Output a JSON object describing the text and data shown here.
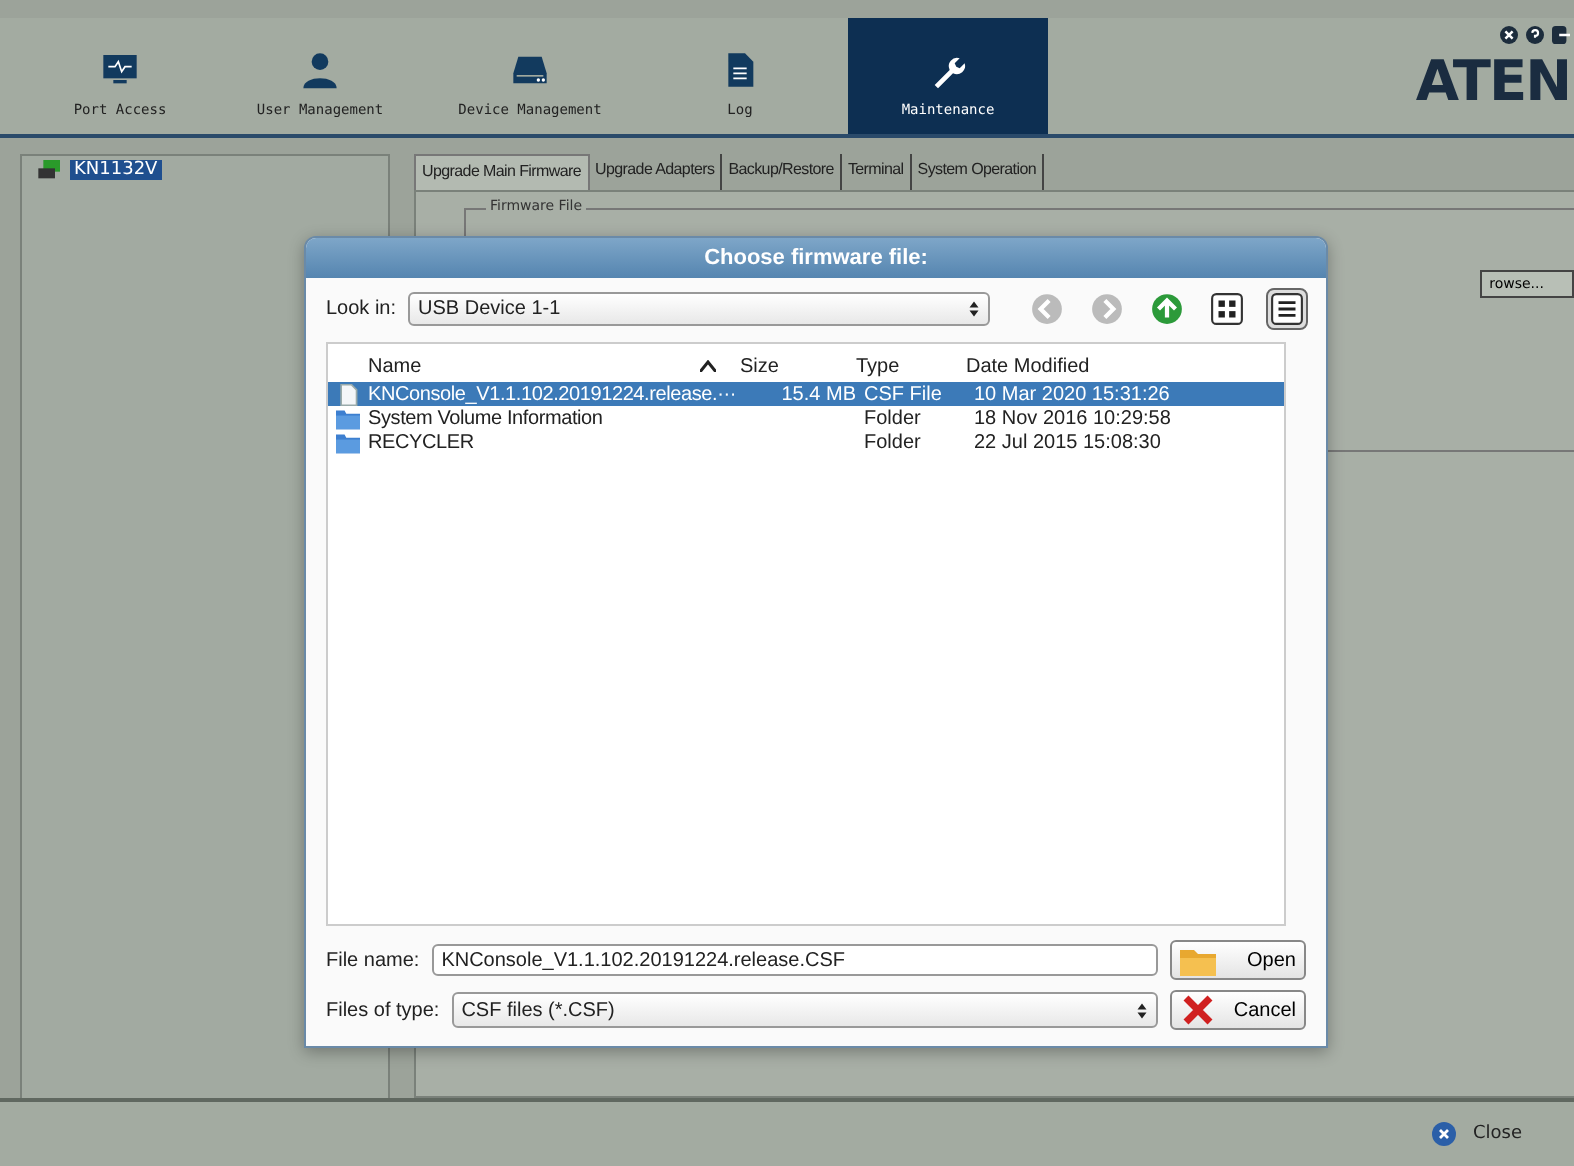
{
  "nav": [
    {
      "label": "Port Access",
      "selected": false
    },
    {
      "label": "User Management",
      "selected": false
    },
    {
      "label": "Device Management",
      "selected": false
    },
    {
      "label": "Log",
      "selected": false
    },
    {
      "label": "Maintenance",
      "selected": true
    }
  ],
  "logo": "ATEN",
  "tree": [
    {
      "label": "KN1132V",
      "selected": true
    }
  ],
  "tabs": [
    {
      "label": "Upgrade Main Firmware",
      "selected": true
    },
    {
      "label": "Upgrade Adapters",
      "selected": false
    },
    {
      "label": "Backup/Restore",
      "selected": false
    },
    {
      "label": "Terminal",
      "selected": false
    },
    {
      "label": "System Operation",
      "selected": false
    }
  ],
  "firmware_group": {
    "legend": "Firmware File",
    "browse_button": "rowse..."
  },
  "dialog": {
    "title": "Choose firmware file:",
    "look_in_label": "Look in:",
    "look_in_value": "USB Device 1-1",
    "view_buttons": [
      {
        "selected": false
      },
      {
        "selected": true
      }
    ],
    "columns": [
      "Name",
      "Size",
      "Type",
      "Date Modified"
    ],
    "rows": [
      {
        "kind": "file",
        "name": "KNConsole_V1.1.102.20191224.release.···",
        "size": "15.4 MB",
        "type": "CSF File",
        "date": "10 Mar 2020 15:31:26",
        "selected": true
      },
      {
        "kind": "folder",
        "name": "System Volume Information",
        "type": "Folder",
        "date": "18 Nov 2016 10:29:58",
        "selected": false
      },
      {
        "kind": "folder",
        "name": "RECYCLER",
        "type": "Folder",
        "date": "22 Jul 2015 15:08:30",
        "selected": false
      }
    ],
    "file_name_label": "File name:",
    "file_name_value": "KNConsole_V1.1.102.20191224.release.CSF",
    "file_type_label": "Files of type:",
    "file_type_value": "CSF files (*.CSF)",
    "open_button": "Open",
    "cancel_button": "Cancel"
  },
  "close_button": "Close"
}
